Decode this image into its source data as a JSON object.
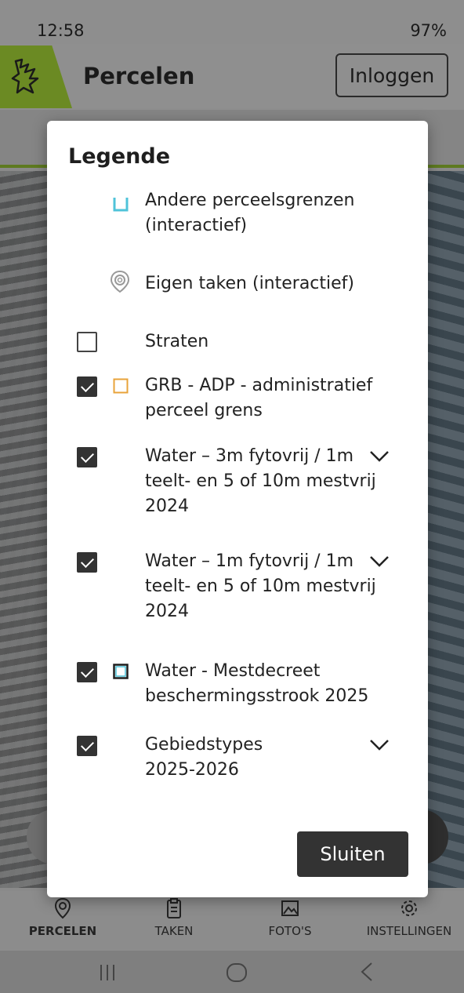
{
  "status": {
    "time": "12:58",
    "indicators": "🔔 · 97%",
    "battery": "97%"
  },
  "app": {
    "title": "Percelen",
    "login_label": "Inloggen"
  },
  "legend": {
    "title": "Legende",
    "items": [
      {
        "label": "Andere perceelsgrenzen (interactief)",
        "checkbox": "none",
        "symbol": "cyan-open-square",
        "expandable": false
      },
      {
        "label": "Eigen taken (interactief)",
        "checkbox": "none",
        "symbol": "location-pin-icon",
        "expandable": false
      },
      {
        "label": "Straten",
        "checkbox": "unchecked",
        "symbol": "none",
        "expandable": false
      },
      {
        "label": "GRB - ADP - administratief perceel grens",
        "checkbox": "checked",
        "symbol": "orange-square",
        "expandable": false
      },
      {
        "label": "Water – 3m fytovrij / 1m teelt- en 5 of 10m mestvrij 2024",
        "checkbox": "checked",
        "symbol": "none",
        "expandable": true
      },
      {
        "label": "Water – 1m fytovrij / 1m teelt- en 5 of 10m mestvrij 2024",
        "checkbox": "checked",
        "symbol": "none",
        "expandable": true
      },
      {
        "label": "Water - Mestdecreet beschermingsstrook 2025",
        "checkbox": "checked",
        "symbol": "cyan-dark-square",
        "expandable": false
      },
      {
        "label": "Gebiedstypes 2025-2026",
        "checkbox": "checked",
        "symbol": "none",
        "expandable": true
      }
    ],
    "close_label": "Sluiten"
  },
  "nav": {
    "items": [
      {
        "label": "PERCELEN",
        "icon": "location-pin-icon",
        "active": true
      },
      {
        "label": "TAKEN",
        "icon": "clipboard-icon",
        "active": false
      },
      {
        "label": "FOTO'S",
        "icon": "photo-icon",
        "active": false
      },
      {
        "label": "INSTELLINGEN",
        "icon": "gear-icon",
        "active": false
      }
    ]
  },
  "colors": {
    "brand_green": "#6b8a23",
    "cyan": "#4fc3d9",
    "orange": "#e8a33a",
    "dark_button": "#333333"
  }
}
